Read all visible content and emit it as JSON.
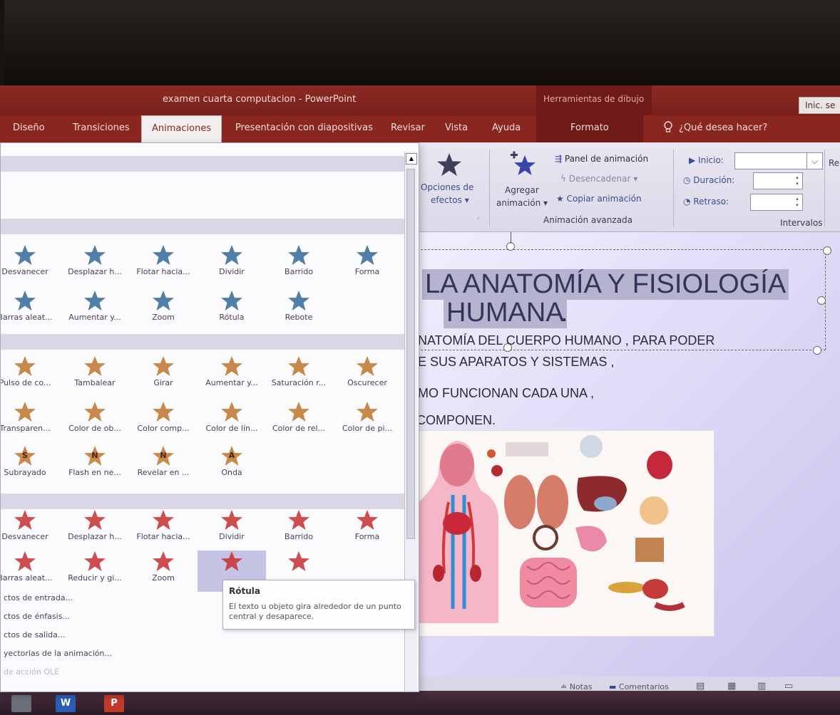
{
  "window": {
    "title": "examen cuarta computacion - PowerPoint",
    "context_title": "Herramientas de dibujo",
    "signin_label": "Inic. se"
  },
  "tabs": [
    {
      "label": "Diseño"
    },
    {
      "label": "Transiciones"
    },
    {
      "label": "Animaciones",
      "active": true
    },
    {
      "label": "Presentación con diapositivas"
    },
    {
      "label": "Revisar"
    },
    {
      "label": "Vista"
    },
    {
      "label": "Ayuda"
    },
    {
      "label": "Formato"
    }
  ],
  "tell_me": "¿Qué desea hacer?",
  "ribbon": {
    "effect_options": {
      "line1": "Opciones de",
      "line2": "efectos ▾"
    },
    "add_animation": {
      "line1": "Agregar",
      "line2": "animación ▾"
    },
    "animation_panel": "Panel de animación",
    "trigger": "Desencadenar ▾",
    "copy_animation": "Copiar animación",
    "advanced_group": "Animación avanzada",
    "start_label": "Inicio:",
    "duration_label": "Duración:",
    "delay_label": "Retraso:",
    "timing_group": "Intervalos",
    "reorder_cut": "Re"
  },
  "gallery": {
    "entrance": [
      {
        "label": "Desvanecer"
      },
      {
        "label": "Desplazar h..."
      },
      {
        "label": "Flotar hacia..."
      },
      {
        "label": "Dividir"
      },
      {
        "label": "Barrido"
      },
      {
        "label": "Forma"
      },
      {
        "label": "Barras aleat..."
      },
      {
        "label": "Aumentar y..."
      },
      {
        "label": "Zoom"
      },
      {
        "label": "Rótula"
      },
      {
        "label": "Rebote"
      }
    ],
    "emphasis": [
      {
        "label": "Pulso de co..."
      },
      {
        "label": "Tambalear"
      },
      {
        "label": "Girar"
      },
      {
        "label": "Aumentar y..."
      },
      {
        "label": "Saturación r..."
      },
      {
        "label": "Oscurecer"
      },
      {
        "label": "Transparen..."
      },
      {
        "label": "Color de ob..."
      },
      {
        "label": "Color comp..."
      },
      {
        "label": "Color de lín..."
      },
      {
        "label": "Color de rel..."
      },
      {
        "label": "Color de pi..."
      },
      {
        "label": "Subrayado",
        "glyph": "S"
      },
      {
        "label": "Flash en ne...",
        "glyph": "N"
      },
      {
        "label": "Revelar en ...",
        "glyph": "N"
      },
      {
        "label": "Onda",
        "glyph": "A"
      }
    ],
    "exit": [
      {
        "label": "Desvanecer"
      },
      {
        "label": "Desplazar h..."
      },
      {
        "label": "Flotar hacia..."
      },
      {
        "label": "Dividir"
      },
      {
        "label": "Barrido"
      },
      {
        "label": "Forma"
      },
      {
        "label": "Barras aleat..."
      },
      {
        "label": "Reducir y gi..."
      },
      {
        "label": "Zoom"
      },
      {
        "label": ""
      },
      {
        "label": ""
      }
    ],
    "links": [
      "ctos de entrada...",
      "ctos de énfasis...",
      "ctos de salida...",
      "yectorias de la animación...",
      "de acción OLE"
    ],
    "colors": {
      "entrance": "#4f7fa6",
      "emphasis": "#c9894a",
      "exit": "#c8383a"
    }
  },
  "tooltip": {
    "title": "Rótula",
    "body": "El texto u objeto gira alrededor de un punto central y desaparece."
  },
  "slide": {
    "title_line1": "LA ANATOMÍA Y FISIOLOGÍA",
    "title_line2": "HUMANA",
    "title_dot": ".",
    "body": [
      "NATOMÍA DEL CUERPO HUMANO , PARA PODER",
      "E SUS APARATOS Y SISTEMAS ,",
      "MO FUNCIONAN CADA UNA ,",
      "COMPONEN."
    ]
  },
  "status": {
    "notes": "Notas",
    "comments": "Comentarios"
  },
  "taskbar": {
    "word": "W",
    "powerpoint": "P"
  }
}
